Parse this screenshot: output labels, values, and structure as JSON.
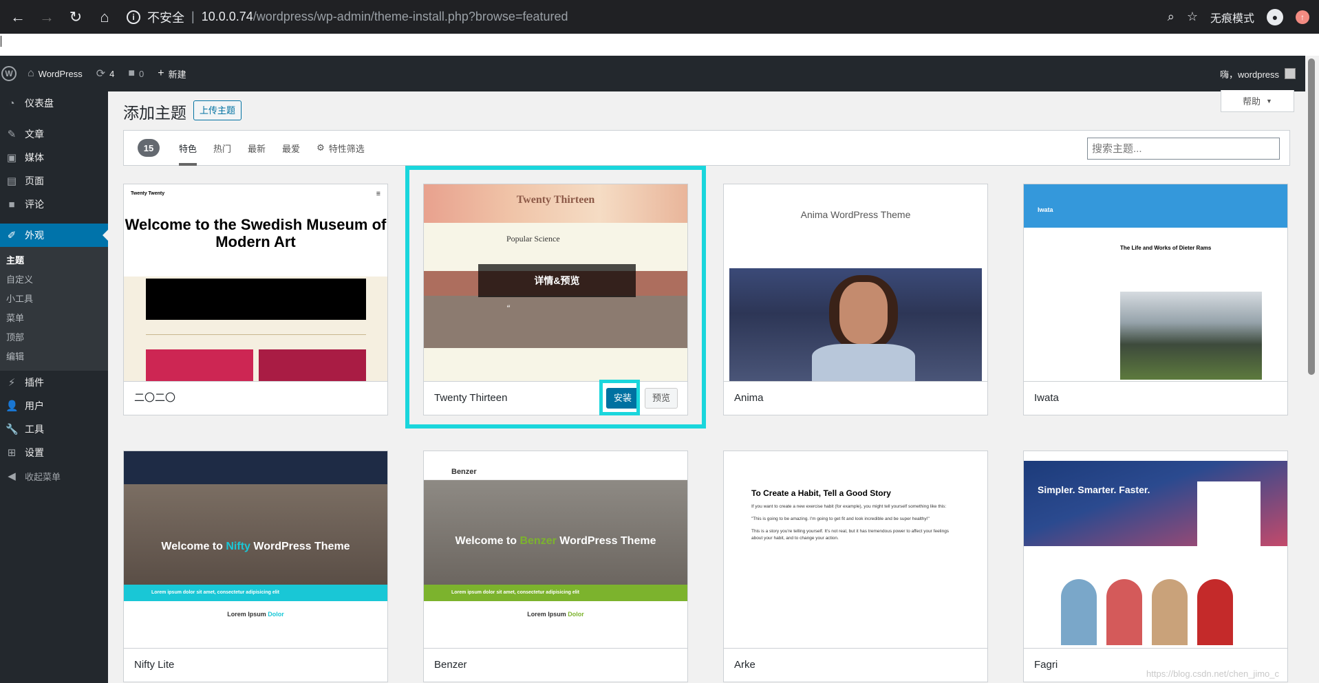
{
  "browser": {
    "insecure_label": "不安全",
    "url_host": "10.0.0.74",
    "url_path": "/wordpress/wp-admin/theme-install.php?browse=featured",
    "incognito_label": "无痕模式"
  },
  "adminbar": {
    "site_name": "WordPress",
    "updates_count": "4",
    "comments_count": "0",
    "new_label": "新建",
    "greeting": "嗨，wordpress"
  },
  "sidebar": {
    "dashboard": "仪表盘",
    "posts": "文章",
    "media": "媒体",
    "pages": "页面",
    "comments": "评论",
    "appearance": "外观",
    "submenu": [
      "主题",
      "自定义",
      "小工具",
      "菜单",
      "顶部",
      "编辑"
    ],
    "plugins": "插件",
    "users": "用户",
    "tools": "工具",
    "settings": "设置",
    "collapse": "收起菜单"
  },
  "header": {
    "title": "添加主题",
    "upload_label": "上传主题",
    "help_label": "帮助"
  },
  "filter": {
    "count": "15",
    "tabs": [
      "特色",
      "热门",
      "最新",
      "最爱",
      "特性筛选"
    ],
    "search_placeholder": "搜索主题..."
  },
  "themes": [
    {
      "name": "二〇二〇"
    },
    {
      "name": "Twenty Thirteen",
      "overlay": "详情&预览",
      "install": "安装",
      "preview": "预览"
    },
    {
      "name": "Anima"
    },
    {
      "name": "Iwata"
    },
    {
      "name": "Nifty Lite"
    },
    {
      "name": "Benzer"
    },
    {
      "name": "Arke"
    },
    {
      "name": "Fagri"
    }
  ],
  "screens": {
    "t2020_heading": "Welcome to the Swedish Museum of Modern Art",
    "t2020_brand": "Twenty Twenty",
    "t2013_title": "Twenty Thirteen",
    "t2013_post": "Popular Science",
    "anima_title": "Anima WordPress Theme",
    "iwata_logo": "Iwata",
    "iwata_heading": "The Life and Works of Dieter Rams",
    "nifty_heading_a": "Welcome to",
    "nifty_heading_b": "Nifty",
    "nifty_heading_c": "WordPress Theme",
    "nifty_band": "Lorem ipsum dolor sit amet, consectetur adipisicing elit",
    "nifty_lower_a": "Lorem Ipsum",
    "nifty_lower_b": "Dolor",
    "benzer_logo": "Benzer",
    "benzer_heading_a": "Welcome to",
    "benzer_heading_b": "Benzer",
    "benzer_heading_c": "WordPress Theme",
    "benzer_band": "Lorem ipsum dolor sit amet, consectetur adipisicing elit",
    "benzer_lower_a": "Lorem Ipsum",
    "benzer_lower_b": "Dolor",
    "arke_title": "To Create a Habit, Tell a Good Story",
    "arke_p1": "If you want to create a new exercise habit (for example), you might tell yourself something like this:",
    "arke_p2": "\"This is going to be amazing. I'm going to get fit and look incredible and be super healthy!\"",
    "arke_p3": "This is a story you're telling yourself. It's not real, but it has tremendous power to affect your feelings about your habit, and to change your action.",
    "fagri_heading": "Simpler. Smarter. Faster."
  },
  "watermark": "https://blog.csdn.net/chen_jimo_c",
  "colors": {
    "accent": "#0073aa",
    "highlight": "#1ad6dc",
    "adminbar": "#23282d"
  }
}
